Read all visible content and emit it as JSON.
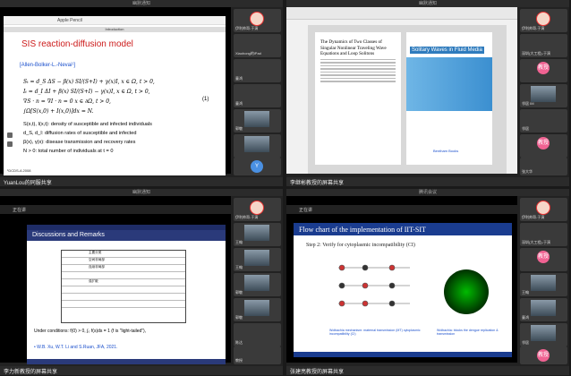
{
  "q1": {
    "title": "幽默通知",
    "slide": {
      "toolbar": "Apple Pencil",
      "header": "Introduction",
      "title": "SIS reaction-diffusion model",
      "ref": "[Allen-Bolker-L.-Nevai¹]",
      "eq_lines": [
        "Sₜ = d_S ΔS − β(x) SI/(S+I) + γ(x)I,   x ∈ Ω, t > 0,",
        "Iₜ = d_I ΔI + β(x) SI/(S+I) − γ(x)I,   x ∈ Ω, t > 0,",
        "∇S · n = ∇I · n = 0            x ∈ ∂Ω, t > 0,",
        "∫Ω[S(x,0) + I(x,0)]dx = N."
      ],
      "eq_num": "(1)",
      "bullets": [
        "S(x,t), I(x,t): density of susceptible and infected individuals",
        "d_S, d_I: diffusion rates of susceptible and infected",
        "β(x), γ(x): disease transmission and recovery rates",
        "N > 0: total number of individuals at t = 0"
      ],
      "footnote": "¹DCDS-A 2008"
    },
    "bottom_name": "YuanLou的同服共享",
    "side": [
      "伊利帅哥-于演 ",
      "Xiaohong的iPad",
      "童鸿",
      "童鸿",
      "郭敬",
      "",
      "Y"
    ]
  },
  "q2": {
    "title": "幽默通知",
    "paper1_title": "The Dynamics of Two Classes of Singular Nonlinear Traveling Wave Equations and Loop Solitons",
    "paper2_title": "Solitary Waves in Fluid Media",
    "paper2_logo": "Bentham Books",
    "bottom_name": "李继彬教授的屏幕共享",
    "side": [
      "伊利帅哥-于演 ",
      "深圳(大工程)-于演",
      "教授",
      "邻居 IM",
      "邻居",
      "教授",
      "张大华"
    ]
  },
  "q3": {
    "title": "幽默通知",
    "topbar": "正在讲",
    "header": "Discussions and Remarks",
    "under": "Under conditions: f(0) > 0, ∫₀ f(s)ds = 1 (f is \"light-tailed\"),",
    "ref": "• W.B. Xu, W.T. Li and S.Ruan, JFA, 2021.",
    "rows": [
      "主要分类",
      "空间非局部",
      "连续非局部",
      "",
      "强扩散",
      "",
      "",
      ""
    ],
    "bottom_name": "李力新教授的屏幕共享",
    "side": [
      "伊利帅哥-于演",
      "王翰",
      "王翰",
      "郭敬",
      "郭敬",
      "陈达",
      "",
      "教授"
    ]
  },
  "q4": {
    "title": "腾讯会议",
    "topbar": "正在讲",
    "header": "Flow chart of the implementation of IIT-SIT",
    "step": "Step 2: Verify for cytoplasmic incompatibility (CI)",
    "cap1": "Wolbachia mechanism: maternal transmission (MT) cytoplasmic incompatibility (CI)",
    "cap2": "Wolbachia: blocks the dengue replication & transmission",
    "bottom_name": "张建亮教授的屏幕共享",
    "side": [
      "伊利帅哥-于演 ",
      "深圳(大工程)-于演",
      "教授",
      "王翰",
      "童鸿",
      "邻居",
      "教授"
    ]
  }
}
